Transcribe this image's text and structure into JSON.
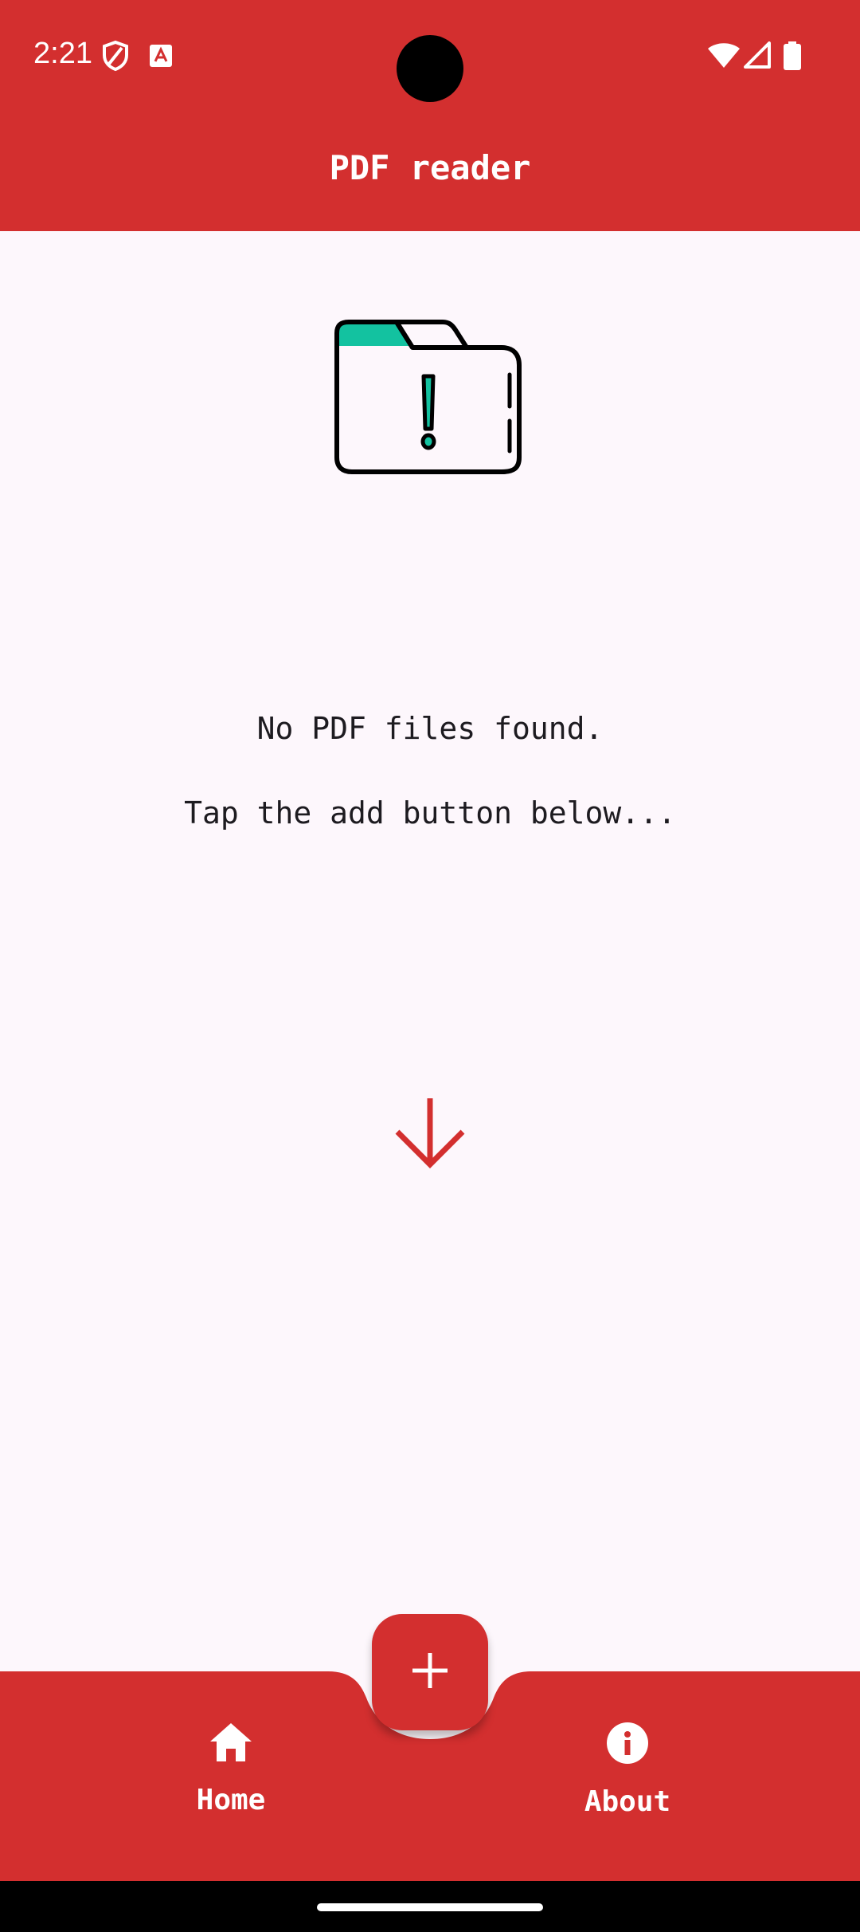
{
  "status_bar": {
    "time": "2:21",
    "icons": [
      "shield-icon",
      "text-a-icon",
      "wifi-icon",
      "signal-icon",
      "battery-icon"
    ]
  },
  "app_bar": {
    "title": "PDF reader"
  },
  "empty_state": {
    "illustration": "folder-alert-icon",
    "message": "No PDF files found.",
    "hint": "Tap the add button below..."
  },
  "fab": {
    "icon": "plus-icon"
  },
  "bottom_nav": {
    "items": [
      {
        "label": "Home",
        "icon": "home-icon"
      },
      {
        "label": "About",
        "icon": "info-icon"
      }
    ]
  },
  "colors": {
    "primary": "#d32f2f",
    "background": "#fdf7fc",
    "accent": "#13c2a0",
    "on_primary": "#ffffff"
  }
}
